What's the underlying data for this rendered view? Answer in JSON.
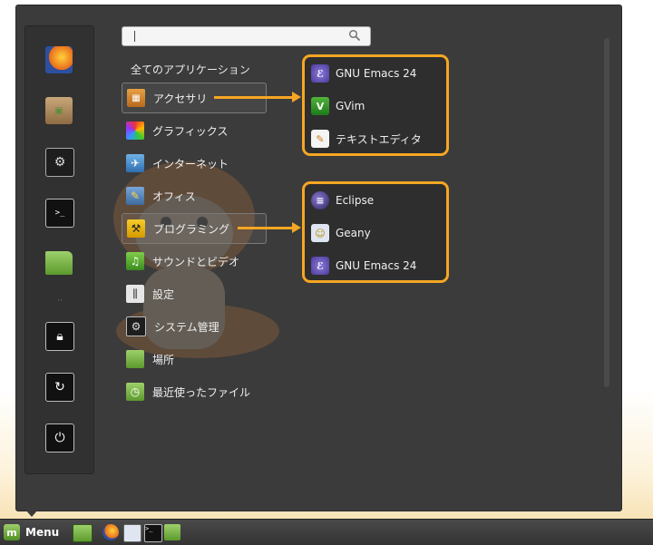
{
  "search": {
    "value": "",
    "placeholder": ""
  },
  "all_applications_label": "全てのアプリケーション",
  "categories": [
    {
      "label": "アクセサリ",
      "icon": "accessories-icon",
      "selected": true
    },
    {
      "label": "グラフィックス",
      "icon": "graphics-icon",
      "selected": false
    },
    {
      "label": "インターネット",
      "icon": "internet-icon",
      "selected": false
    },
    {
      "label": "オフィス",
      "icon": "office-icon",
      "selected": false
    },
    {
      "label": "プログラミング",
      "icon": "programming-icon",
      "selected": true
    },
    {
      "label": "サウンドとビデオ",
      "icon": "sound-video-icon",
      "selected": false
    },
    {
      "label": "設定",
      "icon": "settings-icon",
      "selected": false
    },
    {
      "label": "システム管理",
      "icon": "system-admin-icon",
      "selected": false
    },
    {
      "label": "場所",
      "icon": "places-icon",
      "selected": false
    },
    {
      "label": "最近使ったファイル",
      "icon": "recent-files-icon",
      "selected": false
    }
  ],
  "accessories_apps": [
    {
      "label": "GNU Emacs 24",
      "icon": "emacs-icon"
    },
    {
      "label": "GVim",
      "icon": "gvim-icon"
    },
    {
      "label": "テキストエディタ",
      "icon": "text-editor-icon"
    }
  ],
  "programming_apps": [
    {
      "label": "Eclipse",
      "icon": "eclipse-icon"
    },
    {
      "label": "Geany",
      "icon": "geany-icon"
    },
    {
      "label": "GNU Emacs 24",
      "icon": "emacs-icon"
    }
  ],
  "favorites": [
    "firefox-icon",
    "software-manager-icon",
    "system-settings-icon",
    "terminal-icon",
    "files-icon",
    "lock-screen-icon",
    "logout-icon",
    "shutdown-icon"
  ],
  "taskbar": {
    "menu_label": "Menu",
    "launchers": [
      "show-desktop-icon",
      "firefox-icon",
      "finder-icon",
      "terminal-icon",
      "files-icon"
    ]
  },
  "colors": {
    "highlight": "#f5a623",
    "menu_bg": "#3b3b3b"
  }
}
